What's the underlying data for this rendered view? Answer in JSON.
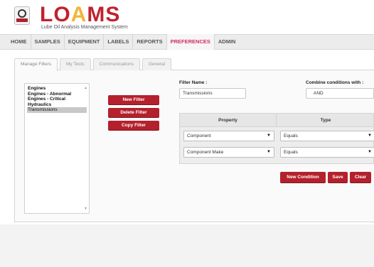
{
  "header": {
    "logo_text_main": "LO",
    "logo_text_accent": "A",
    "logo_text_end": "MS",
    "logo_subtitle": "Lube Oil Analysis Management System"
  },
  "nav": {
    "items": [
      {
        "label": "HOME"
      },
      {
        "label": "SAMPLES"
      },
      {
        "label": "EQUIPMENT"
      },
      {
        "label": "LABELS"
      },
      {
        "label": "REPORTS"
      },
      {
        "label": "PREFERENCES"
      },
      {
        "label": "ADMIN"
      }
    ],
    "active": "PREFERENCES"
  },
  "tabs": [
    {
      "label": "Manage Filters"
    },
    {
      "label": "My Tests"
    },
    {
      "label": "Communications"
    },
    {
      "label": "General"
    }
  ],
  "filters": {
    "items": [
      "Engines",
      "Engines - Abnormal",
      "Engines - Critical",
      "Hydraulics",
      "Transmissions"
    ],
    "selected": "Transmissions"
  },
  "filter_buttons": {
    "new": "New Filter",
    "delete": "Delete Filter",
    "copy": "Copy Filter"
  },
  "filter_name": {
    "label": "Filter Name :",
    "value": "Transmissions"
  },
  "combine": {
    "label": "Combine conditions with :",
    "value": "AND"
  },
  "conditions": {
    "headers": {
      "property": "Property",
      "type": "Type"
    },
    "rows": [
      {
        "property": "Component",
        "type": "Equals"
      },
      {
        "property": "Component Make",
        "type": "Equals"
      }
    ]
  },
  "actions": {
    "new_condition": "New Condition",
    "save": "Save",
    "clear": "Clear"
  },
  "colors": {
    "brand_red": "#b4202c",
    "nav_active": "#d22d63",
    "logo_accent": "#f2b53a"
  }
}
